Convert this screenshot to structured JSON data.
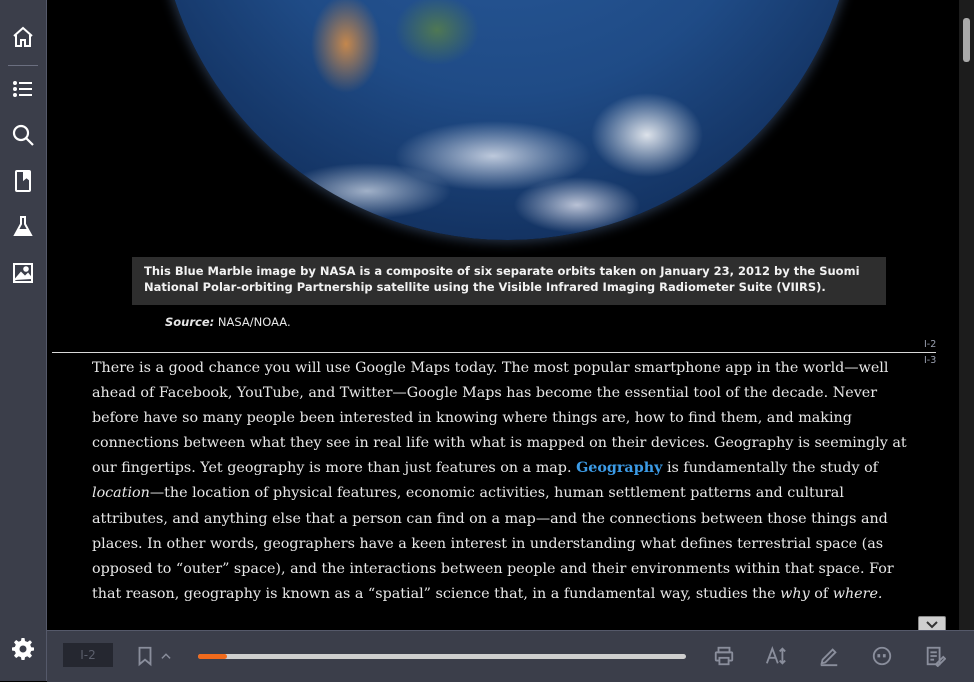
{
  "sidebar": {
    "items": [
      {
        "name": "home-icon"
      },
      {
        "name": "table-of-contents-icon"
      },
      {
        "name": "search-icon"
      },
      {
        "name": "bookmark-page-icon"
      },
      {
        "name": "flask-icon"
      },
      {
        "name": "image-gallery-icon"
      }
    ],
    "settings": "gear-icon"
  },
  "figure": {
    "caption": "This Blue Marble image by NASA is a composite of six separate orbits taken on January 23, 2012 by the Suomi National Polar-orbiting Partnership satellite using the Visible Infrared Imaging Radiometer Suite (VIIRS).",
    "source_label": "Source:",
    "source_value": "NASA/NOAA."
  },
  "page_markers": [
    "I-2",
    "I-3"
  ],
  "body": {
    "p1_a": "There is a good chance you will use Google Maps today. The most popular smartphone app in the world—well ahead of Facebook, YouTube, and Twitter—Google Maps has become the essential tool of the decade. Never before have so many people been interested in knowing where things are, how to find them, and making connections between what they see in real life with what is mapped on their devices. Geography is seemingly at our fingertips. Yet geography is more than just features on a map. ",
    "keyword": "Geography",
    "p1_b": " is fundamentally the study of ",
    "p1_italic1": "location",
    "p1_c": "—the location of physical features, economic activities, human settlement patterns and cultural attributes, and anything else that a person can find on a map—and the connections between those things and places. In other words, geographers have a keen interest in understanding what defines terrestrial space (as opposed to “outer” space), and the interactions between people and their environments within that space. For that reason, geography is known as a “spatial” science that, in a fundamental way, studies the ",
    "p1_italic2": "why",
    "p1_d": " of ",
    "p1_italic3": "where."
  },
  "toolbar": {
    "page_value": "I-2",
    "progress": 0.06,
    "accent": "#f06a1c",
    "icons": [
      "bookmark-icon",
      "chevron-up-icon",
      "print-icon",
      "text-size-icon",
      "highlighter-icon",
      "quote-icon",
      "notes-icon"
    ]
  }
}
